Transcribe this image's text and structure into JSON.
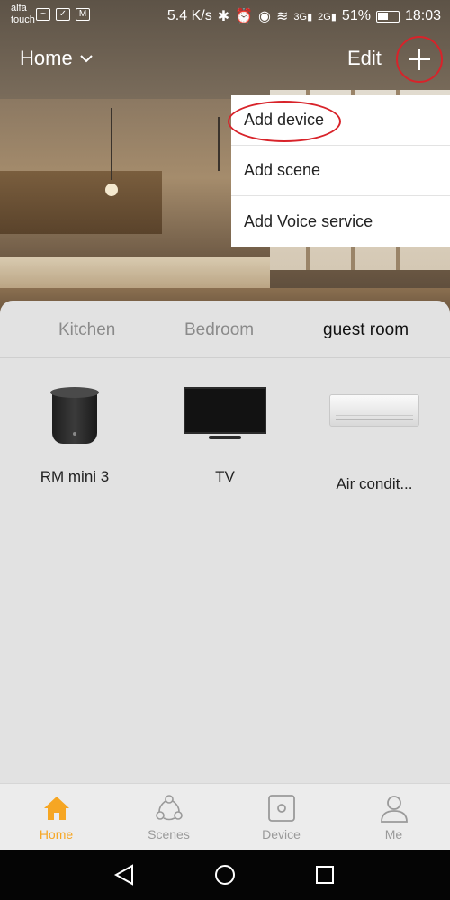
{
  "status_bar": {
    "carrier_line1": "alfa",
    "carrier_line2": "touch",
    "network_speed": "5.4 K/s",
    "signal_3g": "3G",
    "signal_2g": "2G",
    "battery_percent": "51%",
    "time": "18:03"
  },
  "header": {
    "home_label": "Home",
    "edit_label": "Edit",
    "add_icon": "plus-icon"
  },
  "menu": {
    "items": [
      {
        "label": "Add device"
      },
      {
        "label": "Add scene"
      },
      {
        "label": "Add Voice service"
      }
    ]
  },
  "rooms": {
    "tabs": [
      {
        "label": "Kitchen"
      },
      {
        "label": "Bedroom"
      },
      {
        "label": "guest room"
      }
    ],
    "active_index": 2
  },
  "devices": [
    {
      "label": "RM mini 3",
      "icon": "rm-mini-device"
    },
    {
      "label": "TV",
      "icon": "tv-device"
    },
    {
      "label": "Air condit...",
      "icon": "air-conditioner-device"
    }
  ],
  "bottom_nav": {
    "items": [
      {
        "label": "Home",
        "icon": "home-icon"
      },
      {
        "label": "Scenes",
        "icon": "scenes-icon"
      },
      {
        "label": "Device",
        "icon": "device-icon"
      },
      {
        "label": "Me",
        "icon": "person-icon"
      }
    ],
    "active_index": 0
  },
  "colors": {
    "accent": "#f6a623",
    "highlight_ring": "#d8232a",
    "panel_bg": "#e2e2e2"
  }
}
